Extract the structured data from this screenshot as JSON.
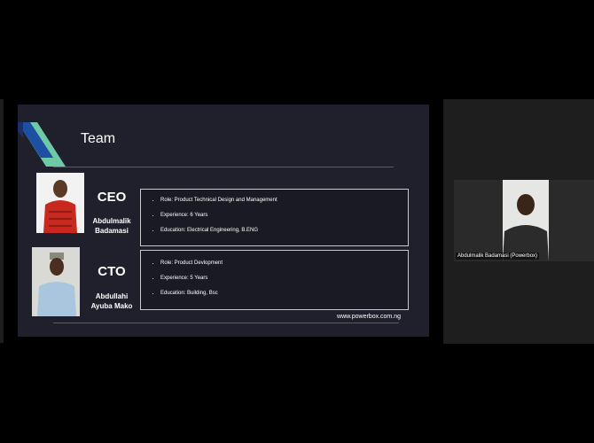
{
  "slide": {
    "title": "Team",
    "website": "www.powerbox.com.ng",
    "accent_colors": {
      "blue": "#1d4fa3",
      "green": "#6ec9a6"
    },
    "members": [
      {
        "role": "CEO",
        "name_line1": "Abdulmalik",
        "name_line2": "Badamasi",
        "details": [
          "Role: Product Technical Design and Management",
          "Experience: 6 Years",
          "Education: Electrical Engineering, B.ENG"
        ]
      },
      {
        "role": "CTO",
        "name_line1": "Abdullahi",
        "name_line2": "Ayuba Mako",
        "details": [
          "Role: Product Devlopment",
          "Experience: 5 Years",
          "Education: Building, Bsc"
        ]
      }
    ]
  },
  "participant": {
    "name": "Abdulmalik Badamasi (Powerbox)"
  }
}
